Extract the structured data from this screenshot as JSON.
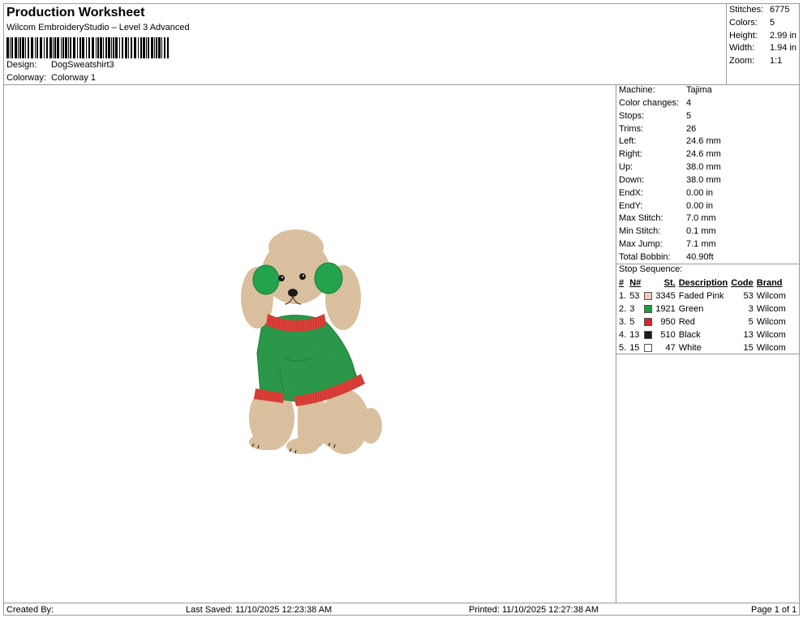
{
  "header": {
    "title": "Production Worksheet",
    "subtitle": "Wilcom EmbroideryStudio – Level 3 Advanced",
    "design_label": "Design:",
    "design_value": "DogSweatshirt3",
    "colorway_label": "Colorway:",
    "colorway_value": "Colorway 1"
  },
  "summary": [
    {
      "label": "Stitches:",
      "value": "6775"
    },
    {
      "label": "Colors:",
      "value": "5"
    },
    {
      "label": "Height:",
      "value": "2.99 in"
    },
    {
      "label": "Width:",
      "value": "1.94 in"
    },
    {
      "label": "Zoom:",
      "value": "1:1"
    }
  ],
  "machine_info": [
    {
      "label": "Machine:",
      "value": "Tajima"
    },
    {
      "label": "Color changes:",
      "value": "4"
    },
    {
      "label": "Stops:",
      "value": "5"
    },
    {
      "label": "Trims:",
      "value": "26"
    },
    {
      "label": "Left:",
      "value": "24.6 mm"
    },
    {
      "label": "Right:",
      "value": "24.6 mm"
    },
    {
      "label": "Up:",
      "value": "38.0 mm"
    },
    {
      "label": "Down:",
      "value": "38.0 mm"
    },
    {
      "label": "EndX:",
      "value": "0.00 in"
    },
    {
      "label": "EndY:",
      "value": "0.00 in"
    },
    {
      "label": "Max Stitch:",
      "value": "7.0 mm"
    },
    {
      "label": "Min Stitch:",
      "value": "0.1 mm"
    },
    {
      "label": "Max Jump:",
      "value": "7.1 mm"
    },
    {
      "label": "Total Bobbin:",
      "value": "40.90ft"
    }
  ],
  "stop_sequence": {
    "title": "Stop Sequence:",
    "columns": [
      "#",
      "N#",
      "St.",
      "Description",
      "Code",
      "Brand"
    ],
    "rows": [
      {
        "idx": "1.",
        "n": "53",
        "color": "#f2c6bd",
        "st": "3345",
        "desc": "Faded Pink",
        "code": "53",
        "brand": "Wilcom"
      },
      {
        "idx": "2.",
        "n": "3",
        "color": "#1f9a45",
        "st": "1921",
        "desc": "Green",
        "code": "3",
        "brand": "Wilcom"
      },
      {
        "idx": "3.",
        "n": "5",
        "color": "#d6262e",
        "st": "950",
        "desc": "Red",
        "code": "5",
        "brand": "Wilcom"
      },
      {
        "idx": "4.",
        "n": "13",
        "color": "#1a1a1a",
        "st": "510",
        "desc": "Black",
        "code": "13",
        "brand": "Wilcom"
      },
      {
        "idx": "5.",
        "n": "15",
        "color": "#ffffff",
        "st": "47",
        "desc": "White",
        "code": "15",
        "brand": "Wilcom"
      }
    ]
  },
  "footer": {
    "created_by": "Created By:",
    "last_saved": "Last Saved: 11/10/2025 12:23:38 AM",
    "printed": "Printed: 11/10/2025 12:27:38 AM",
    "page": "Page 1 of 1"
  },
  "colors": {
    "fur": "#dcc2a0",
    "sweater_green": "#2a9448",
    "trim_red": "#d63a36",
    "earmuff_green": "#22a04a"
  }
}
